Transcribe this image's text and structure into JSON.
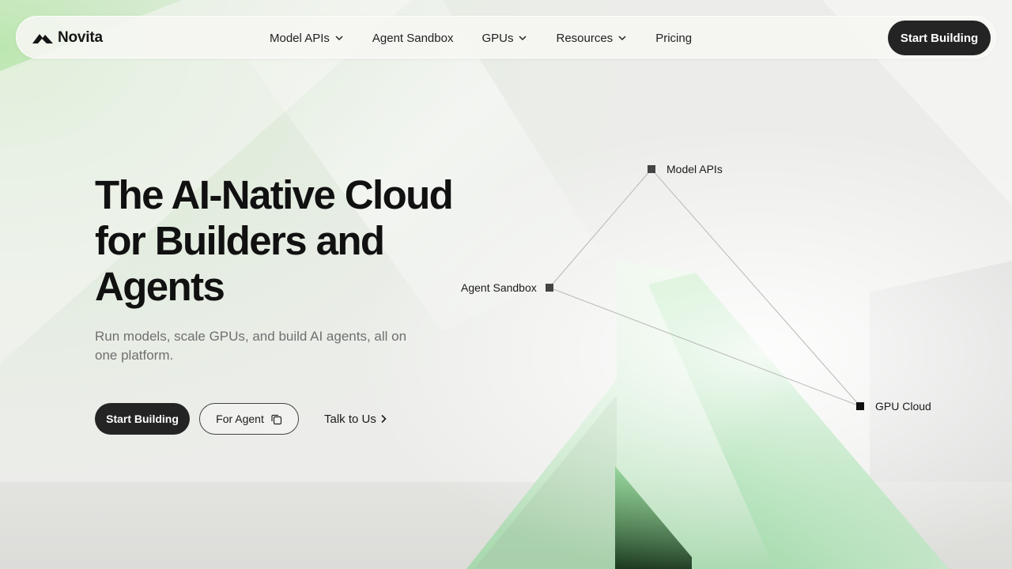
{
  "colors": {
    "dark": "#242424",
    "accent_green": "#7fd68f",
    "background": "#ecedea"
  },
  "nav": {
    "logo_icon": "novita-peak-logo-icon",
    "brand": "Novita",
    "items": [
      {
        "label": "Model APIs",
        "has_dropdown": true
      },
      {
        "label": "Agent Sandbox",
        "has_dropdown": false
      },
      {
        "label": "GPUs",
        "has_dropdown": true
      },
      {
        "label": "Resources",
        "has_dropdown": true
      },
      {
        "label": "Pricing",
        "has_dropdown": false
      }
    ],
    "cta": "Start Building"
  },
  "hero": {
    "title": "The AI-Native Cloud for Builders and Agents",
    "subtitle": "Run models, scale GPUs, and build AI agents, all on one platform.",
    "primary_button": "Start Building",
    "agent_button": "For Agent",
    "agent_button_icon": "copy-icon",
    "link": "Talk to Us",
    "link_icon": "chevron-right-icon"
  },
  "diagram": {
    "nodes": [
      {
        "label": "Model APIs"
      },
      {
        "label": "Agent Sandbox"
      },
      {
        "label": "GPU Cloud"
      }
    ]
  }
}
